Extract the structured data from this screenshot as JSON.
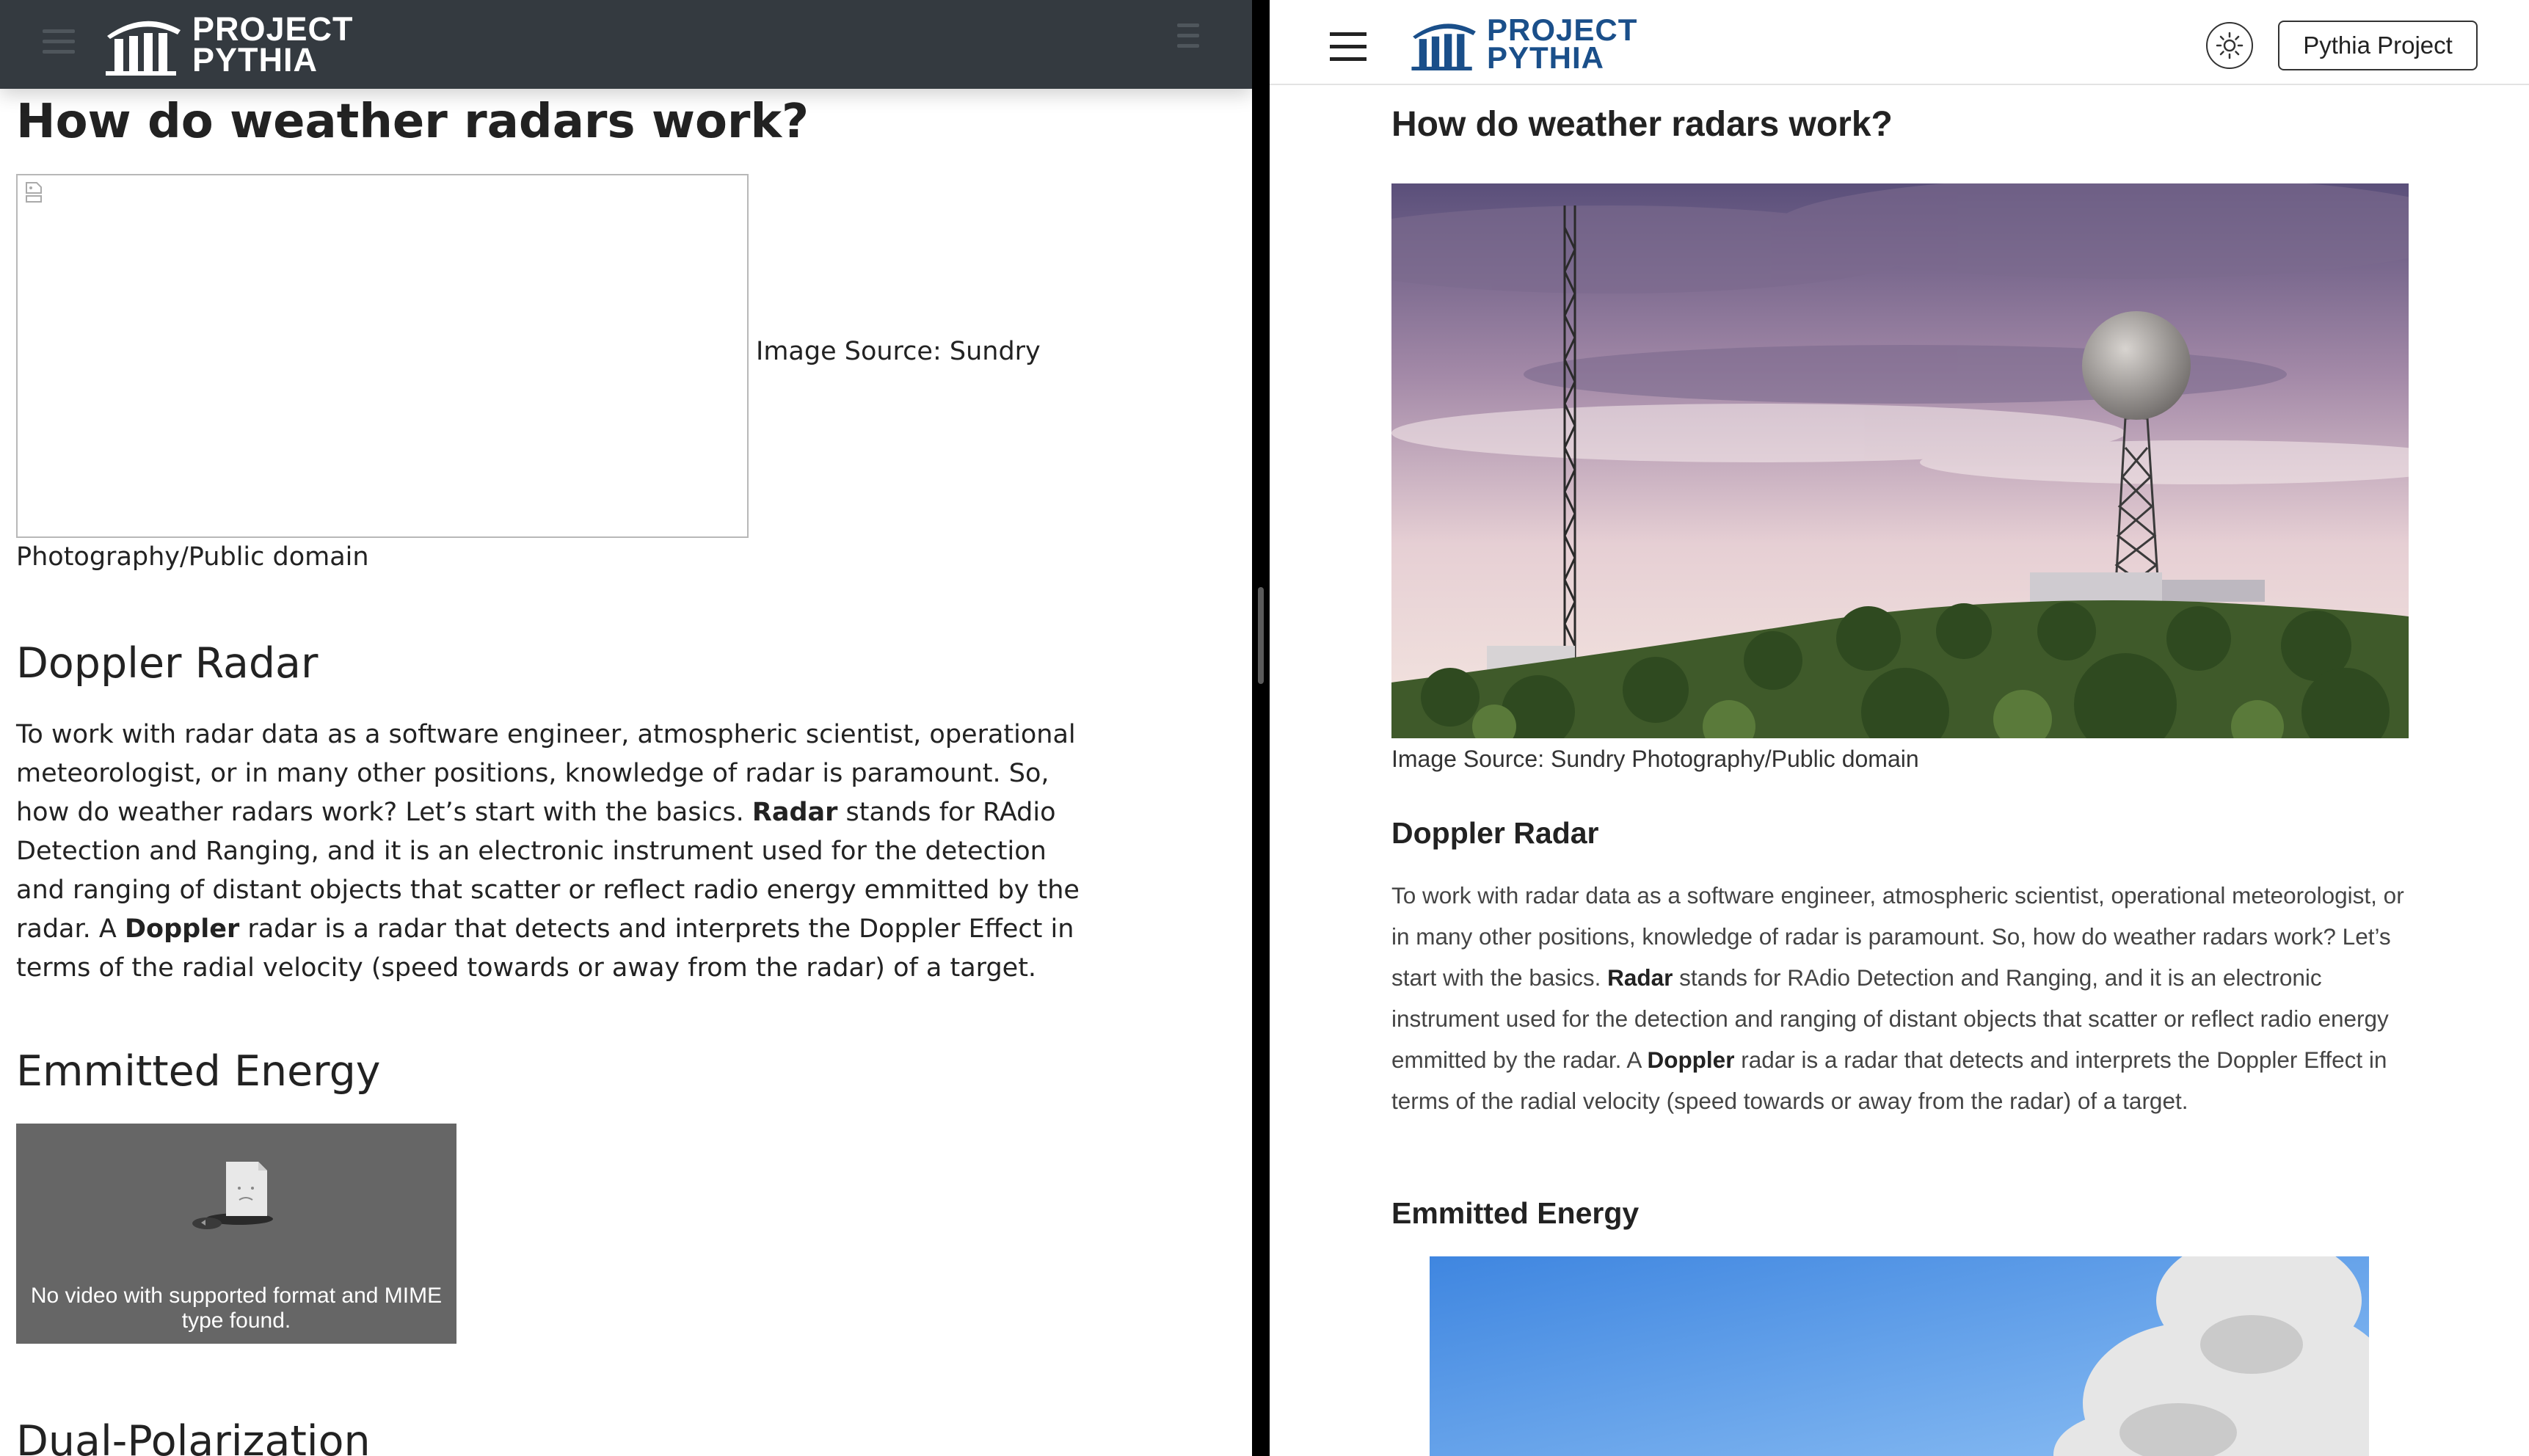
{
  "left_pane": {
    "logo": {
      "line1": "PROJECT",
      "line2": "PYTHIA"
    },
    "title": "How do weather radars work?",
    "image_caption_part1": "Image Source: Sundry",
    "image_caption_part2": "Photography/Public domain",
    "section_doppler": "Doppler Radar",
    "paragraph": {
      "p1": "To work with radar data as a software engineer, atmospheric scientist, operational meteorologist, or in many other positions, knowledge of radar is paramount. So, how do weather radars work? Let’s start with the basics. ",
      "b1": "Radar",
      "p2": " stands for RAdio Detection and Ranging, and it is an electronic instrument used for the detection and ranging of distant objects that scatter or reflect radio energy emmitted by the radar. A ",
      "b2": "Doppler",
      "p3": " radar is a radar that detects and interprets the Doppler Effect in terms of the radial velocity (speed towards or away from the radar) of a target."
    },
    "section_energy": "Emmitted Energy",
    "video_message": "No video with supported format and MIME type found.",
    "section_dualpol": "Dual-Polarization"
  },
  "right_pane": {
    "logo": {
      "line1": "PROJECT",
      "line2": "PYTHIA"
    },
    "project_button": "Pythia Project",
    "title": "How do weather radars work?",
    "image_caption": "Image Source: Sundry Photography/Public domain",
    "section_doppler": "Doppler Radar",
    "paragraph": {
      "p1": "To work with radar data as a software engineer, atmospheric scientist, operational meteorologist, or in many other positions, knowledge of radar is paramount. So, how do weather radars work? Let’s start with the basics. ",
      "b1": "Radar",
      "p2": " stands for RAdio Detection and Ranging, and it is an electronic instrument used for the detection and ranging of distant objects that scatter or reflect radio energy emmitted by the radar. A ",
      "b2": "Doppler",
      "p3": " radar is a radar that detects and interprets the Doppler Effect in terms of the radial velocity (speed towards or away from the radar) of a target."
    },
    "section_energy": "Emmitted Energy"
  },
  "colors": {
    "left_navbar": "#343a40",
    "right_logo": "#1a4f8a",
    "divider": "#000000",
    "video_bg": "#666666"
  },
  "icons": [
    "menu-icon",
    "toc-icon",
    "logo-columns-icon",
    "broken-image-icon",
    "sad-file-icon",
    "sun-icon"
  ]
}
